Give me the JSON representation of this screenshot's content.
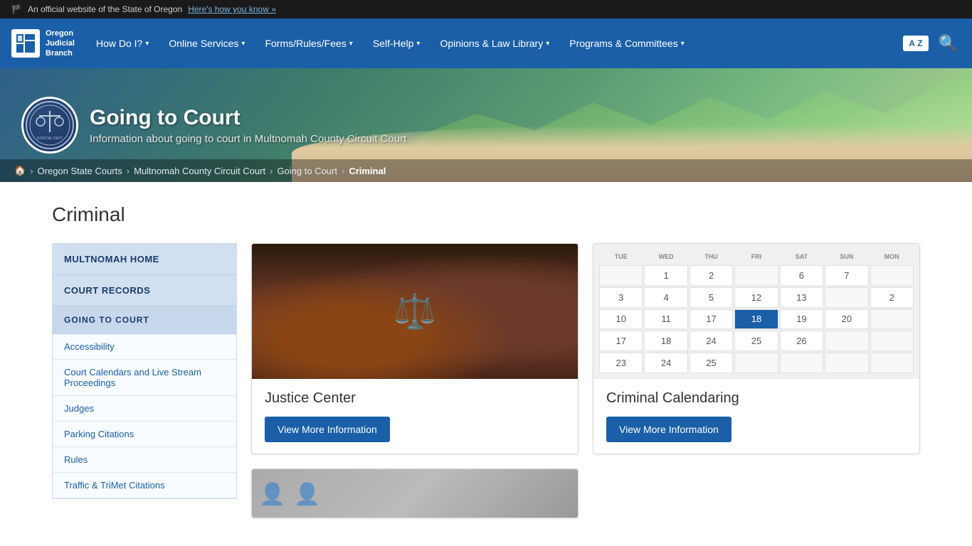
{
  "govBar": {
    "text": "An official website of the State of Oregon",
    "linkText": "Here's how you know »",
    "flagEmoji": "🏴"
  },
  "nav": {
    "logoLine1": "Oregon",
    "logoLine2": "Judicial",
    "logoLine3": "Branch",
    "items": [
      {
        "label": "How Do I?",
        "hasDropdown": true
      },
      {
        "label": "Online Services",
        "hasDropdown": true
      },
      {
        "label": "Forms/Rules/Fees",
        "hasDropdown": true
      },
      {
        "label": "Self-Help",
        "hasDropdown": true
      },
      {
        "label": "Opinions & Law Library",
        "hasDropdown": true
      },
      {
        "label": "Programs & Committees",
        "hasDropdown": true
      }
    ],
    "translateLabel": "A Z",
    "searchAriaLabel": "Search"
  },
  "hero": {
    "title": "Going to Court",
    "subtitle": "Information about going to court in Multnomah County Circuit Court",
    "sealText": "JUDICIAL DEPARTMENT STATE OF OREGON"
  },
  "breadcrumb": {
    "home": "🏠",
    "items": [
      {
        "label": "Oregon State Courts",
        "href": "#"
      },
      {
        "label": "Multnomah County Circuit Court",
        "href": "#"
      },
      {
        "label": "Going to Court",
        "href": "#"
      },
      {
        "label": "Criminal",
        "current": true
      }
    ]
  },
  "pageTitle": "Criminal",
  "sidebar": {
    "homeLabel": "MULTNOMAH HOME",
    "courtRecordsLabel": "COURT RECORDS",
    "goingToCourtLabel": "GOING TO COURT",
    "links": [
      {
        "label": "Accessibility"
      },
      {
        "label": "Court Calendars and Live Stream Proceedings"
      },
      {
        "label": "Judges"
      },
      {
        "label": "Parking Citations"
      },
      {
        "label": "Rules"
      },
      {
        "label": "Traffic & TriMet Citations"
      }
    ]
  },
  "cards": [
    {
      "id": "justice-center",
      "title": "Justice Center",
      "buttonLabel": "View More Information",
      "imageType": "courtroom"
    },
    {
      "id": "criminal-calendaring",
      "title": "Criminal Calendaring",
      "buttonLabel": "View More Information",
      "imageType": "calendar"
    }
  ],
  "calendar": {
    "headers": [
      "TUE",
      "WED",
      "THU",
      "FRI",
      "SAT",
      "SUN",
      "MON"
    ],
    "rows": [
      [
        "",
        "1",
        "2",
        "6",
        "7",
        ""
      ],
      [
        "3",
        "4",
        "5",
        "12",
        "13",
        ""
      ],
      [
        "10",
        "11",
        "17",
        "18",
        "19",
        "20"
      ],
      [
        "17",
        "18",
        "24",
        "25",
        "26",
        ""
      ],
      [
        "23",
        "24",
        "25",
        "",
        "",
        ""
      ]
    ],
    "days": [
      "",
      "1",
      "2",
      "",
      "",
      "",
      "6",
      "7",
      "3",
      "4",
      "5",
      "12",
      "13",
      "",
      "10",
      "11",
      "17",
      "18",
      "19",
      "20",
      "17",
      "18",
      "24",
      "25",
      "26",
      "2",
      "23",
      "24",
      "25",
      "",
      "",
      ""
    ]
  }
}
